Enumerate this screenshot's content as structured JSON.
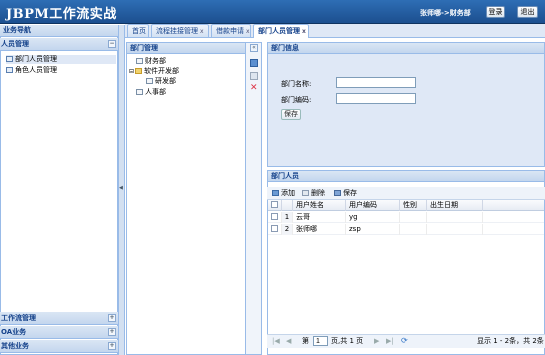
{
  "header": {
    "title": "JBPM工作流实战",
    "user": "张师哪->财务部",
    "login_btn": "登录",
    "logout_btn": "退出"
  },
  "leftnav": {
    "title": "业务导航",
    "sections": [
      {
        "label": "人员管理",
        "toggle": "−"
      },
      {
        "label": "工作流管理",
        "toggle": "+"
      },
      {
        "label": "OA业务",
        "toggle": "+"
      },
      {
        "label": "其他业务",
        "toggle": "+"
      }
    ],
    "items": [
      "部门人员管理",
      "角色人员管理"
    ],
    "collapse_icon": "◀"
  },
  "tabs": [
    {
      "label": "首页",
      "close": ""
    },
    {
      "label": "流程挂接管理",
      "close": "x"
    },
    {
      "label": "借款申请",
      "close": "x"
    },
    {
      "label": "部门人员管理",
      "close": "x"
    }
  ],
  "tree": {
    "title": "部门管理",
    "nodes": [
      "财务部",
      "软件开发部",
      "研发部",
      "人事部"
    ],
    "collapse": "«"
  },
  "dept_info": {
    "title": "部门信息",
    "name_label": "部门名称:",
    "code_label": "部门编码:",
    "name_value": "",
    "code_value": "",
    "save": "保存"
  },
  "staff": {
    "title": "部门人员",
    "toolbar": {
      "add": "添加",
      "delete": "删除",
      "save": "保存"
    },
    "columns": [
      "用户姓名",
      "用户编码",
      "性别",
      "出生日期"
    ],
    "rows": [
      {
        "num": "1",
        "name": "云哥",
        "code": "yg",
        "gender": "",
        "birth": ""
      },
      {
        "num": "2",
        "name": "张师哪",
        "code": "zsp",
        "gender": "",
        "birth": ""
      }
    ],
    "pager": {
      "page_prefix": "第",
      "page": "1",
      "page_suffix": "页,共 1 页",
      "summary": "显示 1 - 2条，共 2条"
    }
  }
}
